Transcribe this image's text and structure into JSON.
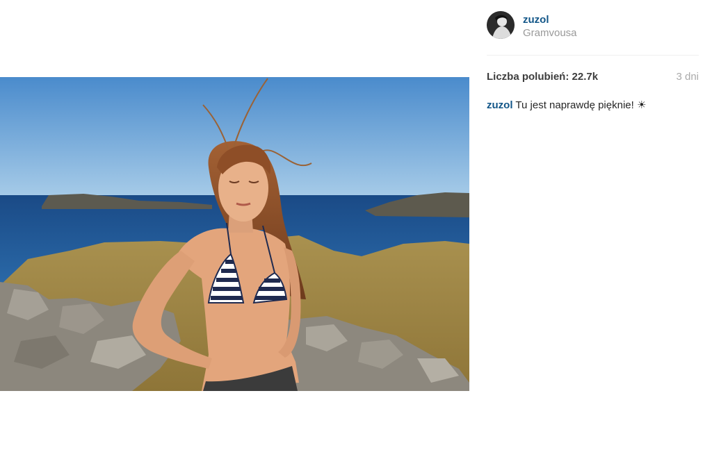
{
  "post": {
    "username": "zuzol",
    "location": "Gramvousa",
    "likes_label": "Liczba polubień:",
    "likes_count": "22.7k",
    "time_ago": "3 dni",
    "caption_user": "zuzol",
    "caption_text": "Tu jest naprawdę pięknie! ☀"
  },
  "photo": {
    "subject": "woman in striped bikini on rocky hilltop by the sea",
    "colors": {
      "sky_top": "#4e8fcf",
      "sky_bottom": "#9ac4e6",
      "sea": "#1d4f8c",
      "land": "#a58d4e",
      "rock": "#8a8478",
      "skin": "#e0a078",
      "hair": "#8a4a26"
    }
  },
  "colors": {
    "username": "#125688",
    "secondary_text": "#999999",
    "body_text": "#262626",
    "divider": "#efefef"
  }
}
